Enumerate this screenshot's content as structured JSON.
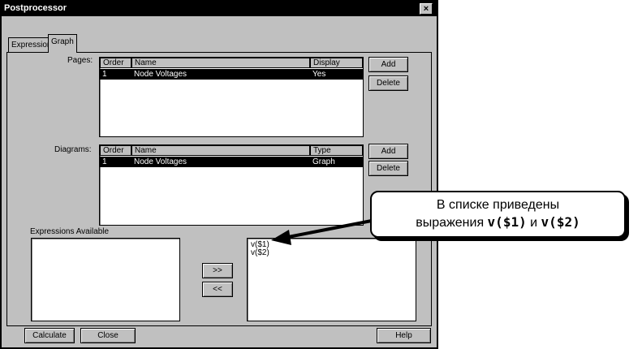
{
  "window": {
    "title": "Postprocessor",
    "close_icon": "×"
  },
  "tabs": [
    {
      "label": "Expression"
    },
    {
      "label": "Graph"
    }
  ],
  "pages": {
    "label": "Pages:",
    "columns": [
      "Order",
      "Name",
      "Display"
    ],
    "rows": [
      {
        "order": "1",
        "name": "Node Voltages",
        "display": "Yes"
      }
    ],
    "add_label": "Add",
    "delete_label": "Delete"
  },
  "diagrams": {
    "label": "Diagrams:",
    "columns": [
      "Order",
      "Name",
      "Type"
    ],
    "rows": [
      {
        "order": "1",
        "name": "Node Voltages",
        "type": "Graph"
      }
    ],
    "add_label": "Add",
    "delete_label": "Delete"
  },
  "expressions": {
    "label": "Expressions Available",
    "selected": [
      "v($1)",
      "v($2)"
    ],
    "move_right_label": ">>",
    "move_left_label": "<<"
  },
  "footer": {
    "calculate_label": "Calculate",
    "close_label": "Close",
    "help_label": "Help"
  },
  "callout": {
    "line1": "В списке приведены",
    "prefix": "выражения ",
    "expr1": "v($1)",
    "conj": " и ",
    "expr2": "v($2)"
  }
}
